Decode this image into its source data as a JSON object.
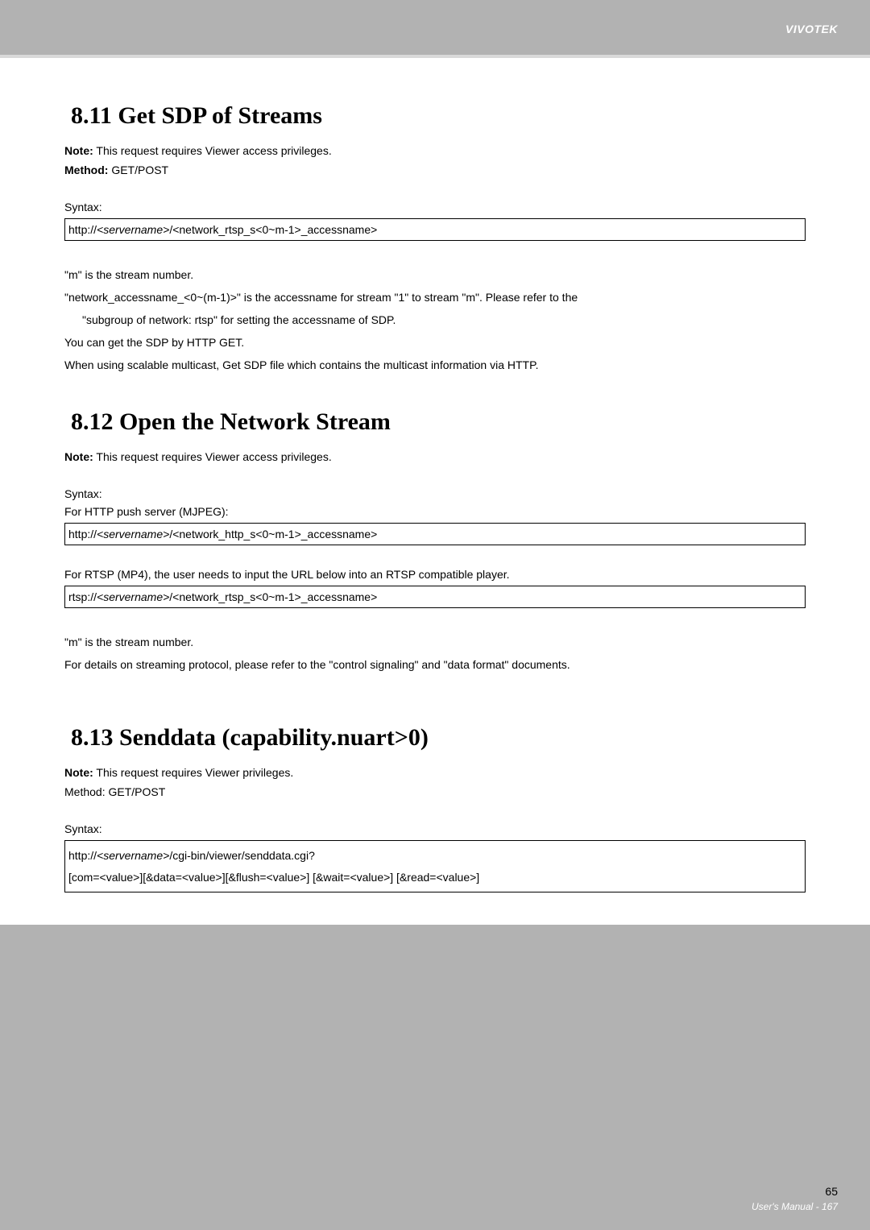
{
  "brand": "VIVOTEK",
  "section1": {
    "heading": "8.11 Get SDP of Streams",
    "note_label": "Note:",
    "note_text": " This request requires Viewer access privileges.",
    "method_label": "Method:",
    "method_text": " GET/POST",
    "syntax_label": "Syntax:",
    "syntax_prefix": "http://",
    "syntax_italic": "<servername>",
    "syntax_suffix": "/<network_rtsp_s<0~m-1>_accessname>",
    "para1": "\"m\" is the stream number.",
    "para2": "\"network_accessname_<0~(m-1)>\" is the accessname for stream \"1\" to stream \"m\". Please refer to the",
    "para2_indent": "\"subgroup of network: rtsp\" for setting the accessname of SDP.",
    "para3": "You can get the SDP by HTTP GET.",
    "para4": "When using scalable multicast, Get SDP file which contains the multicast information via HTTP."
  },
  "section2": {
    "heading": "8.12 Open the Network Stream",
    "note_label": "Note:",
    "note_text": " This request requires Viewer access privileges.",
    "syntax_label": "Syntax:",
    "sub_label1": "For HTTP push server (MJPEG):",
    "syntax1_prefix": "http://",
    "syntax1_italic": "<servername>",
    "syntax1_suffix": "/<network_http_s<0~m-1>_accessname>",
    "sub_label2": "For RTSP (MP4), the user needs to input the URL below into an RTSP compatible player.",
    "syntax2_prefix": "rtsp://",
    "syntax2_italic": "<servername>",
    "syntax2_suffix": "/<network_rtsp_s<0~m-1>_accessname>",
    "para1": "\"m\" is the stream number.",
    "para2": "For details on streaming protocol, please refer to the \"control signaling\" and \"data format\" documents."
  },
  "section3": {
    "heading": "8.13 Senddata (capability.nuart>0)",
    "note_label": "Note:",
    "note_text": " This request requires Viewer privileges.",
    "method_line": "Method: GET/POST",
    "syntax_label": "Syntax:",
    "syntax_line1_prefix": "http://",
    "syntax_line1_italic": "<servername>",
    "syntax_line1_suffix": "/cgi-bin/viewer/senddata.cgi?",
    "syntax_line2": "[com=<value>][&data=<value>][&flush=<value>] [&wait=<value>] [&read=<value>]"
  },
  "footer": {
    "page_num": "65",
    "text": "User's Manual - 167"
  }
}
